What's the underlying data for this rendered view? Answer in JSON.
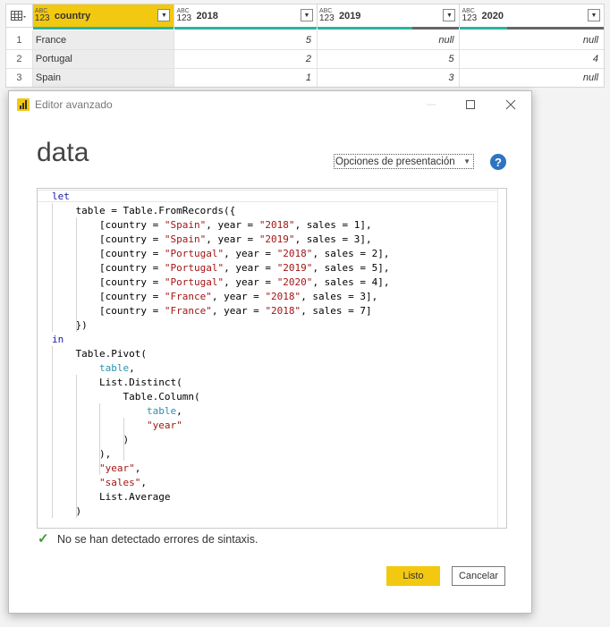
{
  "grid": {
    "columns": [
      {
        "type_top": "ABC",
        "type_bottom": "123",
        "name": "country"
      },
      {
        "type_top": "ABC",
        "type_bottom": "123",
        "name": "2018"
      },
      {
        "type_top": "ABC",
        "type_bottom": "123",
        "name": "2019"
      },
      {
        "type_top": "ABC",
        "type_bottom": "123",
        "name": "2020"
      }
    ],
    "rows": [
      {
        "index": "1",
        "country": "France",
        "y2018": "5",
        "y2019": "null",
        "y2020": "null"
      },
      {
        "index": "2",
        "country": "Portugal",
        "y2018": "2",
        "y2019": "5",
        "y2020": "4"
      },
      {
        "index": "3",
        "country": "Spain",
        "y2018": "1",
        "y2019": "3",
        "y2020": "null"
      }
    ],
    "colors": {
      "selected_header": "#f2c811",
      "quality_valid": "#2bb3a3",
      "quality_empty": "#666666"
    }
  },
  "dialog": {
    "title": "Editor avanzado",
    "query_name": "data",
    "options_label": "Opciones de presentación",
    "help_label": "?",
    "status_text": "No se han detectado errores de sintaxis.",
    "ok_label": "Listo",
    "cancel_label": "Cancelar",
    "icons": [
      "powerbi-icon",
      "minimize-icon",
      "maximize-icon",
      "close-icon",
      "help-icon",
      "check-icon"
    ]
  },
  "code": [
    [
      {
        "t": "let",
        "c": "kw"
      }
    ],
    [
      {
        "t": "    table = Table.FromRecords({"
      }
    ],
    [
      {
        "t": "        [country = "
      },
      {
        "t": "\"Spain\"",
        "c": "str"
      },
      {
        "t": ", year = "
      },
      {
        "t": "\"2018\"",
        "c": "str"
      },
      {
        "t": ", sales = 1],"
      }
    ],
    [
      {
        "t": "        [country = "
      },
      {
        "t": "\"Spain\"",
        "c": "str"
      },
      {
        "t": ", year = "
      },
      {
        "t": "\"2019\"",
        "c": "str"
      },
      {
        "t": ", sales = 3],"
      }
    ],
    [
      {
        "t": "        [country = "
      },
      {
        "t": "\"Portugal\"",
        "c": "str"
      },
      {
        "t": ", year = "
      },
      {
        "t": "\"2018\"",
        "c": "str"
      },
      {
        "t": ", sales = 2],"
      }
    ],
    [
      {
        "t": "        [country = "
      },
      {
        "t": "\"Portugal\"",
        "c": "str"
      },
      {
        "t": ", year = "
      },
      {
        "t": "\"2019\"",
        "c": "str"
      },
      {
        "t": ", sales = 5],"
      }
    ],
    [
      {
        "t": "        [country = "
      },
      {
        "t": "\"Portugal\"",
        "c": "str"
      },
      {
        "t": ", year = "
      },
      {
        "t": "\"2020\"",
        "c": "str"
      },
      {
        "t": ", sales = 4],"
      }
    ],
    [
      {
        "t": "        [country = "
      },
      {
        "t": "\"France\"",
        "c": "str"
      },
      {
        "t": ", year = "
      },
      {
        "t": "\"2018\"",
        "c": "str"
      },
      {
        "t": ", sales = 3],"
      }
    ],
    [
      {
        "t": "        [country = "
      },
      {
        "t": "\"France\"",
        "c": "str"
      },
      {
        "t": ", year = "
      },
      {
        "t": "\"2018\"",
        "c": "str"
      },
      {
        "t": ", sales = 7]"
      }
    ],
    [
      {
        "t": "    })"
      }
    ],
    [
      {
        "t": "in",
        "c": "kw"
      }
    ],
    [
      {
        "t": "    Table.Pivot("
      }
    ],
    [
      {
        "t": "        "
      },
      {
        "t": "table",
        "c": "id"
      },
      {
        "t": ","
      }
    ],
    [
      {
        "t": "        List.Distinct("
      }
    ],
    [
      {
        "t": "            Table.Column("
      }
    ],
    [
      {
        "t": "                "
      },
      {
        "t": "table",
        "c": "id"
      },
      {
        "t": ","
      }
    ],
    [
      {
        "t": "                "
      },
      {
        "t": "\"year\"",
        "c": "str"
      }
    ],
    [
      {
        "t": "            )"
      }
    ],
    [
      {
        "t": "        ),"
      }
    ],
    [
      {
        "t": "        "
      },
      {
        "t": "\"year\"",
        "c": "str"
      },
      {
        "t": ","
      }
    ],
    [
      {
        "t": "        "
      },
      {
        "t": "\"sales\"",
        "c": "str"
      },
      {
        "t": ","
      }
    ],
    [
      {
        "t": "        List.Average"
      }
    ],
    [
      {
        "t": "    )"
      }
    ]
  ]
}
